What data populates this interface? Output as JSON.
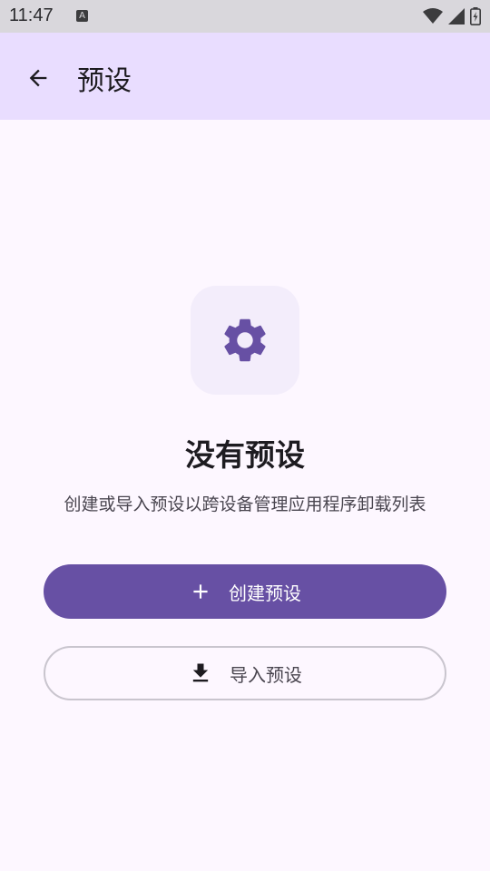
{
  "status_bar": {
    "time": "11:47",
    "notification_letter": "A",
    "icons": [
      "wifi-icon",
      "signal-icon",
      "battery-icon"
    ]
  },
  "app_bar": {
    "title": "预设",
    "back_icon": "arrow-back-icon"
  },
  "empty_state": {
    "icon": "gear-icon",
    "title": "没有预设",
    "description": "创建或导入预设以跨设备管理应用程序卸载列表"
  },
  "actions": {
    "create_label": "创建预设",
    "create_icon": "plus-icon",
    "import_label": "导入预设",
    "import_icon": "download-icon"
  },
  "colors": {
    "primary": "#6750a4",
    "app_bar_bg": "#e9ddff",
    "background": "#fdf7ff"
  }
}
